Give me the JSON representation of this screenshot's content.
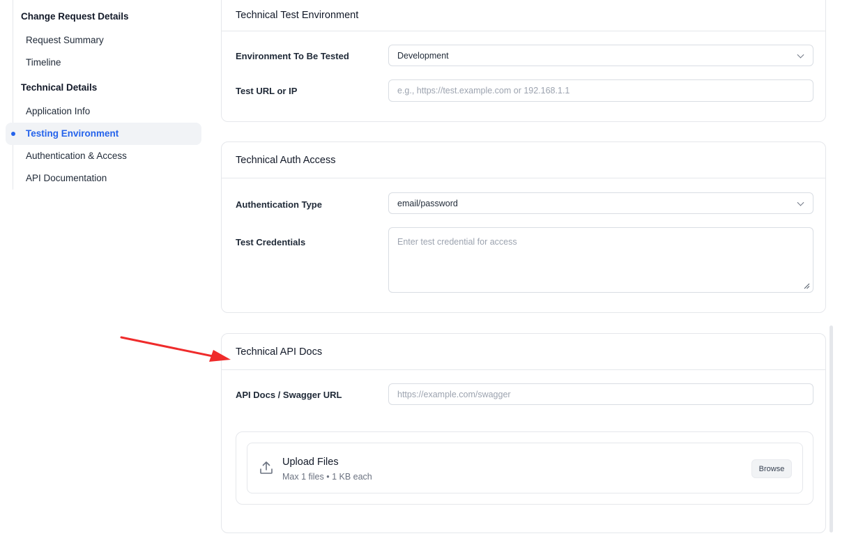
{
  "sidebar": {
    "groups": [
      {
        "title": "Change Request Details",
        "items": [
          {
            "label": "Request Summary"
          },
          {
            "label": "Timeline"
          }
        ]
      },
      {
        "title": "Technical Details",
        "items": [
          {
            "label": "Application Info"
          },
          {
            "label": "Testing Environment",
            "active": true
          },
          {
            "label": "Authentication & Access"
          },
          {
            "label": "API Documentation"
          }
        ]
      }
    ]
  },
  "sections": {
    "test_env": {
      "title": "Technical Test Environment",
      "environment_label": "Environment To Be Tested",
      "environment_value": "Development",
      "url_label": "Test URL or IP",
      "url_placeholder": "e.g., https://test.example.com or 192.168.1.1"
    },
    "auth": {
      "title": "Technical Auth Access",
      "auth_type_label": "Authentication Type",
      "auth_type_value": "email/password",
      "credentials_label": "Test Credentials",
      "credentials_placeholder": "Enter test credential for access"
    },
    "api_docs": {
      "title": "Technical API Docs",
      "url_label": "API Docs / Swagger URL",
      "url_placeholder": "https://example.com/swagger",
      "upload_title": "Upload Files",
      "upload_subtitle": "Max 1 files • 1 KB each",
      "browse_label": "Browse"
    }
  },
  "colors": {
    "accent": "#2563eb",
    "annotation_arrow": "#ef2b2b"
  }
}
